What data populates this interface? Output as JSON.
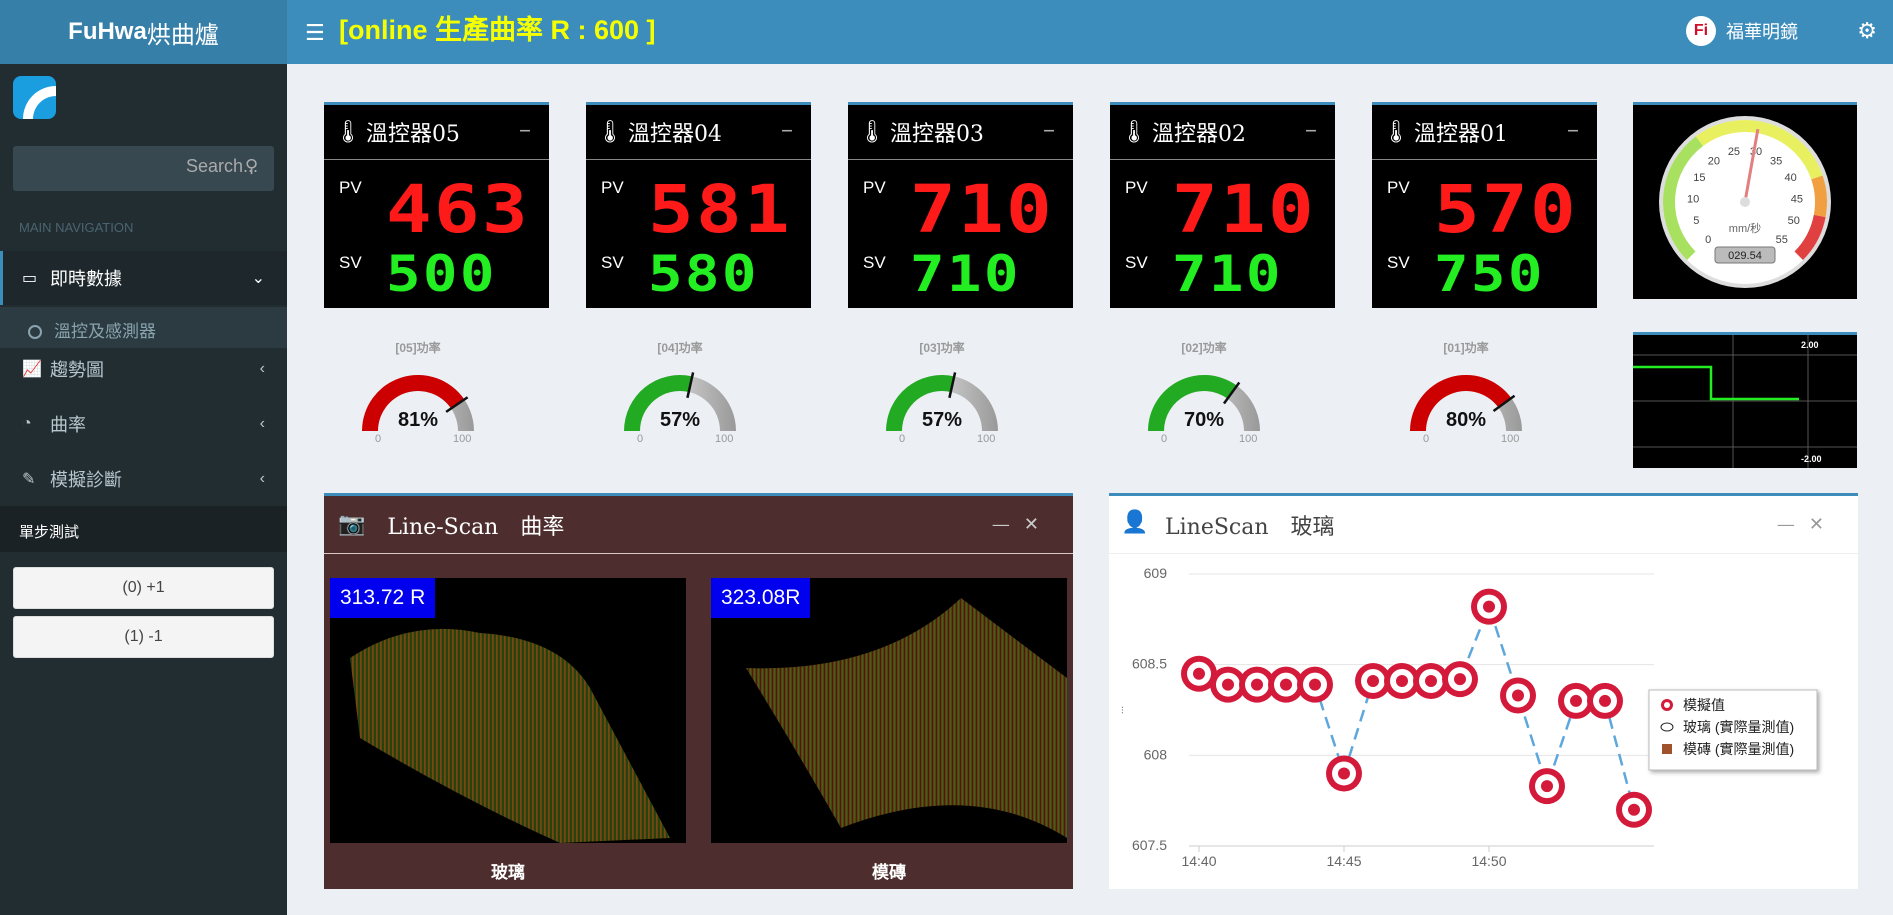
{
  "header": {
    "brand_bold": "FuHwa",
    "brand_rest": "烘曲爐",
    "title": "[online 生產曲率 R : 600 ]",
    "user_name": "福華明鏡",
    "user_logo": "Fi"
  },
  "sidebar": {
    "search_placeholder": "Search...",
    "nav_header": "MAIN NAVIGATION",
    "items": [
      {
        "label": "即時數據"
      },
      {
        "label": "趨勢圖"
      },
      {
        "label": "曲率"
      },
      {
        "label": "模擬診斷"
      }
    ],
    "sub_item": "溫控及感測器",
    "section": "單步測試",
    "buttons": [
      "(0) +1",
      "(1) -1"
    ]
  },
  "controllers": [
    {
      "title": "溫控器05",
      "pv": "463",
      "sv": "500"
    },
    {
      "title": "溫控器04",
      "pv": "581",
      "sv": "580"
    },
    {
      "title": "溫控器03",
      "pv": "710",
      "sv": "710"
    },
    {
      "title": "溫控器02",
      "pv": "710",
      "sv": "710"
    },
    {
      "title": "溫控器01",
      "pv": "570",
      "sv": "750"
    }
  ],
  "pv_label": "PV",
  "sv_label": "SV",
  "gauges": [
    {
      "label": "[05]功率",
      "value": 81,
      "text": "81%",
      "color": "#cc0000"
    },
    {
      "label": "[04]功率",
      "value": 57,
      "text": "57%",
      "color": "#22aa22"
    },
    {
      "label": "[03]功率",
      "value": 57,
      "text": "57%",
      "color": "#22aa22"
    },
    {
      "label": "[02]功率",
      "value": 70,
      "text": "70%",
      "color": "#22aa22"
    },
    {
      "label": "[01]功率",
      "value": 80,
      "text": "80%",
      "color": "#cc0000"
    }
  ],
  "gauge_min": "0",
  "gauge_max": "100",
  "speed_dial": {
    "unit": "mm/秒",
    "readout": "029.54",
    "value": 29.54,
    "ticks": [
      "0",
      "5",
      "10",
      "15",
      "20",
      "25",
      "30",
      "35",
      "40",
      "45",
      "50",
      "55"
    ]
  },
  "mini_chart": {
    "ymax": "2.00",
    "ymin": "-2.00"
  },
  "linescan": {
    "title": "Line-Scan　曲率",
    "left": {
      "value": "313.72 R",
      "caption": "玻璃"
    },
    "right": {
      "value": "323.08R",
      "caption": "模磚"
    }
  },
  "chart_data": {
    "type": "line",
    "title": "LineScan　玻璃",
    "x": [
      "14:40",
      "14:41",
      "14:42",
      "14:43",
      "14:44",
      "14:45",
      "14:46",
      "14:47",
      "14:48",
      "14:49",
      "14:50",
      "14:51",
      "14:52",
      "14:53",
      "14:54",
      "14:55"
    ],
    "xticks": [
      "14:40",
      "14:45",
      "14:50"
    ],
    "ylim": [
      607.5,
      609
    ],
    "yticks": [
      "609",
      "608.5",
      "608",
      "607.5"
    ],
    "series": [
      {
        "name": "模擬值",
        "values": [
          608.45,
          608.39,
          608.39,
          608.39,
          608.39,
          607.9,
          608.41,
          608.41,
          608.41,
          608.42,
          608.82,
          608.33,
          607.83,
          608.3,
          608.3,
          607.7
        ]
      }
    ],
    "legend": [
      "模擬值",
      "玻璃 (實際量測值)",
      "模磚 (實際量測值)"
    ],
    "ylabel": "...",
    "legend_position": "right"
  }
}
